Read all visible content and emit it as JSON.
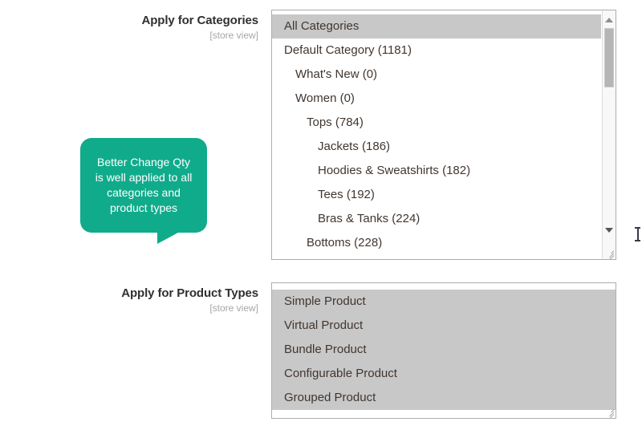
{
  "fields": [
    {
      "title": "Apply for Categories",
      "scope": "[store view]"
    },
    {
      "title": "Apply for Product Types",
      "scope": "[store view]"
    }
  ],
  "categories_field": {
    "title": "Apply for Categories",
    "scope": "[store view]",
    "options": [
      {
        "label": "All Categories",
        "level": 0,
        "selected": true
      },
      {
        "label": "Default Category (1181)",
        "level": 0,
        "selected": false
      },
      {
        "label": "What's New (0)",
        "level": 1,
        "selected": false
      },
      {
        "label": "Women (0)",
        "level": 1,
        "selected": false
      },
      {
        "label": "Tops (784)",
        "level": 2,
        "selected": false
      },
      {
        "label": "Jackets (186)",
        "level": 3,
        "selected": false
      },
      {
        "label": "Hoodies & Sweatshirts (182)",
        "level": 3,
        "selected": false
      },
      {
        "label": "Tees (192)",
        "level": 3,
        "selected": false
      },
      {
        "label": "Bras & Tanks (224)",
        "level": 3,
        "selected": false
      },
      {
        "label": "Bottoms (228)",
        "level": 2,
        "selected": false
      }
    ],
    "scrollbar": {
      "up_arrow_icon": "triangle-up-icon",
      "down_arrow_icon": "triangle-down-icon",
      "thumb_icon": "scrollbar-thumb"
    },
    "resize_handle_icon": "resize-handle-icon"
  },
  "product_types_field": {
    "title": "Apply for Product Types",
    "scope": "[store view]",
    "options": [
      {
        "label": "Simple Product",
        "selected": true
      },
      {
        "label": "Virtual Product",
        "selected": true
      },
      {
        "label": "Bundle Product",
        "selected": true
      },
      {
        "label": "Configurable Product",
        "selected": true
      },
      {
        "label": "Grouped Product",
        "selected": true
      }
    ],
    "resize_handle_icon": "resize-handle-icon"
  },
  "callout": {
    "text": "Better Change Qty\nis well applied to all\ncategories and\nproduct types",
    "background_color": "#10ab8b",
    "text_color": "#ffffff"
  },
  "cursor": {
    "icon": "text-ibeam-cursor"
  },
  "colors": {
    "selected_option_background": "#c8c8c8",
    "listbox_border": "#adadad",
    "label_text": "#303030",
    "scope_text": "#a6a6a6",
    "option_text": "#41362f",
    "accent_green": "#10ab8b"
  }
}
